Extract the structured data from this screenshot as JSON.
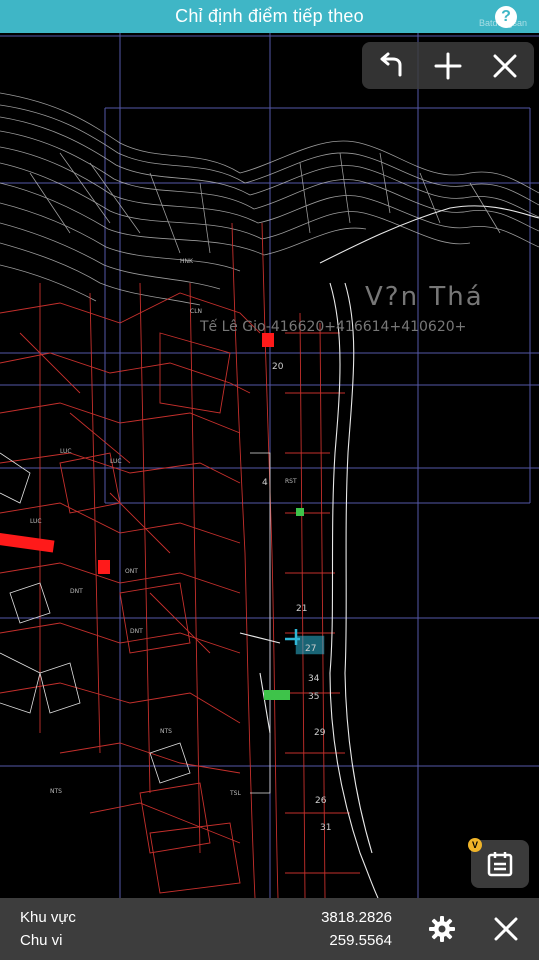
{
  "header": {
    "title": "Chỉ định điểm tiếp theo",
    "help_label": "?",
    "watermark": "Batdongsan"
  },
  "toolbar": {
    "undo_icon": "undo-arrow-icon",
    "add_icon": "plus-icon",
    "close_icon": "close-icon"
  },
  "map": {
    "label_village": "V?n Thá",
    "label_parcels": "Tế Lê  Gio-416620+416614+410620+",
    "parcel_numbers": [
      "20",
      "4",
      "21",
      "27",
      "34",
      "35",
      "29",
      "26",
      "31"
    ],
    "land_codes": [
      "LUC",
      "DNT",
      "ONT",
      "CLN",
      "NTS",
      "RST",
      "TSL",
      "HNK"
    ],
    "colors": {
      "grid": "#6b6fd1",
      "lines_red": "#d0332f",
      "lines_white": "#dcdcdc",
      "highlight": "#2fb7d6",
      "fill_red": "#ff1a1a",
      "fill_green": "#3ec34a"
    }
  },
  "calendar_button": {
    "badge": "V",
    "icon": "calendar-icon"
  },
  "bottom": {
    "area_label": "Khu vực",
    "area_value": "3818.2826",
    "perimeter_label": "Chu vi",
    "perimeter_value": "259.5564",
    "settings_icon": "gear-icon",
    "close_icon": "close-icon"
  }
}
